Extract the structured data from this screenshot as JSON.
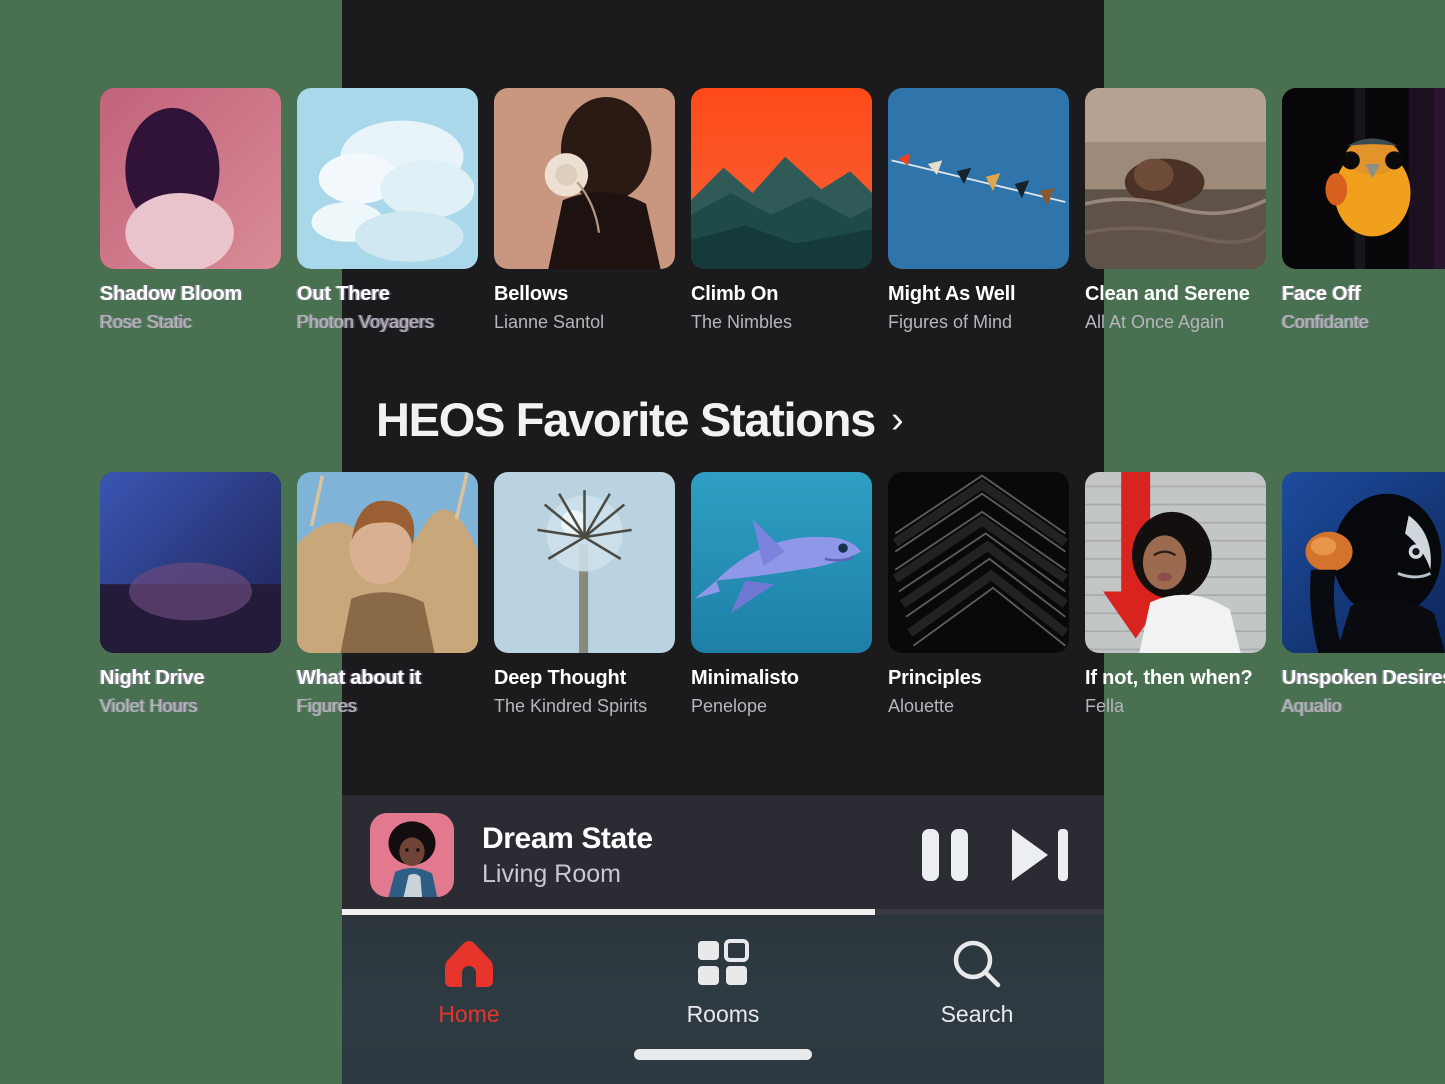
{
  "theme": {
    "backdrop": "#4a7052",
    "panel": "#1b1b1d",
    "nowplaying_bg": "#2b2b33",
    "tabbar_bg": "#2e3b42",
    "accent": "#e8352b",
    "text_primary": "#ffffff",
    "text_secondary": "#b6b6ba"
  },
  "rows": [
    {
      "name": "row-one",
      "tiles": [
        {
          "title": "Shadow Bloom",
          "subtitle": "Rose Static",
          "art": "art-pink-portrait"
        },
        {
          "title": "Out There",
          "subtitle": "Photon Voyagers",
          "art": "art-clouds"
        },
        {
          "title": "Bellows",
          "subtitle": "Lianne Santol",
          "art": "art-flower-portrait"
        },
        {
          "title": "Climb On",
          "subtitle": "The Nimbles",
          "art": "art-sunset-mountains"
        },
        {
          "title": "Might As Well",
          "subtitle": "Figures of Mind",
          "art": "art-bunting-sky"
        },
        {
          "title": "Clean and Serene",
          "subtitle": "All At Once Again",
          "art": "art-floating-water"
        },
        {
          "title": "Face Off",
          "subtitle": "Confidante",
          "art": "art-orange-bird"
        }
      ]
    },
    {
      "name": "row-two",
      "tiles": [
        {
          "title": "Night Drive",
          "subtitle": "Violet Hours",
          "art": "art-blue-violet"
        },
        {
          "title": "What about it",
          "subtitle": "Figures",
          "art": "art-field-portrait"
        },
        {
          "title": "Deep Thought",
          "subtitle": "The Kindred Spirits",
          "art": "art-palm-sphere"
        },
        {
          "title": "Minimalisto",
          "subtitle": "Penelope",
          "art": "art-shark"
        },
        {
          "title": "Principles",
          "subtitle": "Alouette",
          "art": "art-black-chevrons"
        },
        {
          "title": "If not, then when?",
          "subtitle": "Fella",
          "art": "art-red-arrow-portrait"
        },
        {
          "title": "Unspoken Desires",
          "subtitle": "Aqualio",
          "art": "art-blue-fruit-portrait"
        }
      ]
    }
  ],
  "section": {
    "title": "HEOS Favorite Stations",
    "chevron": "›"
  },
  "now_playing": {
    "title": "Dream State",
    "room": "Living Room",
    "art": "art-np-portrait",
    "pause_label": "Pause",
    "next_label": "Next track",
    "progress_percent": 70
  },
  "tabbar": {
    "items": [
      {
        "label": "Home",
        "icon": "home-icon",
        "active": true
      },
      {
        "label": "Rooms",
        "icon": "grid-icon",
        "active": false
      },
      {
        "label": "Search",
        "icon": "search-icon",
        "active": false
      }
    ]
  }
}
